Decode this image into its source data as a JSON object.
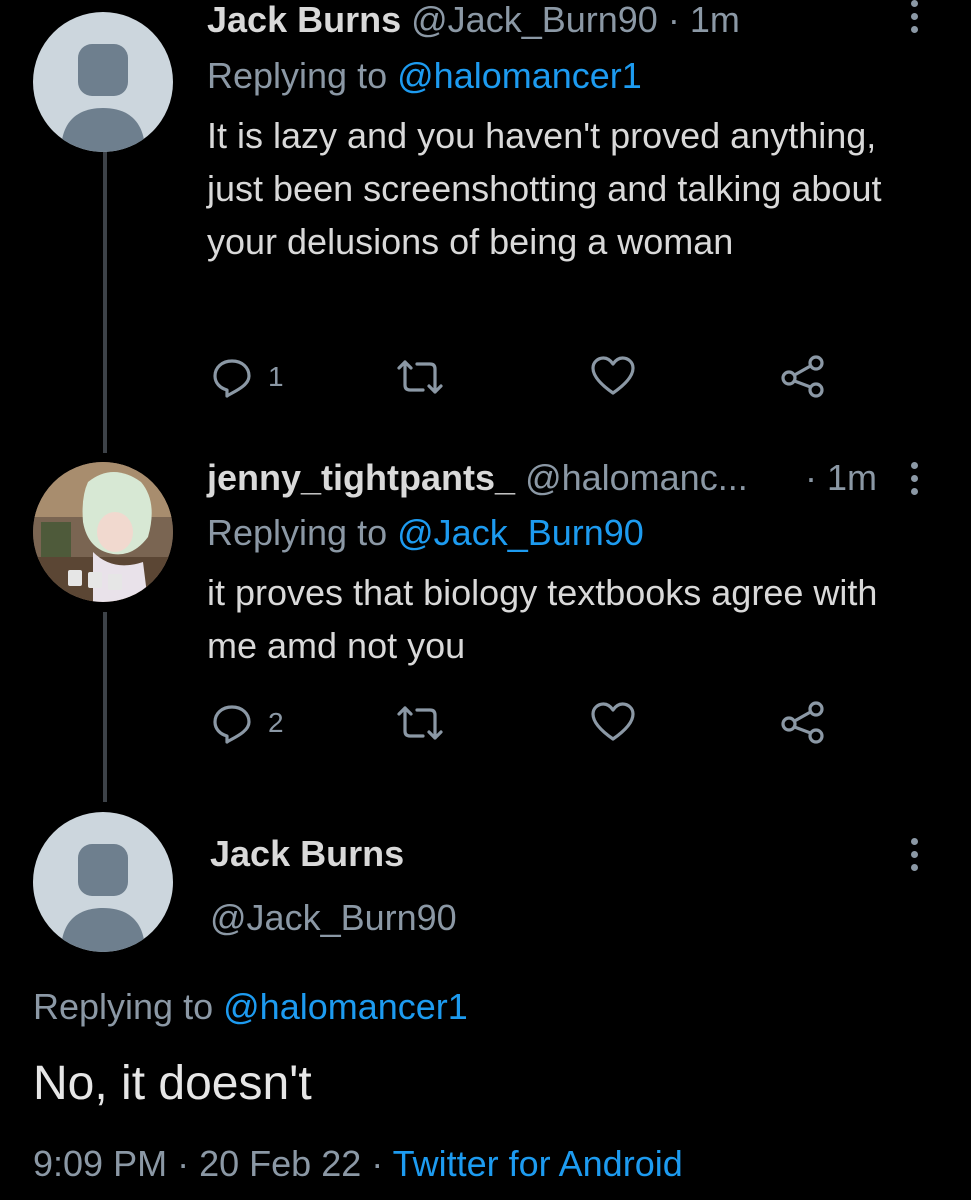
{
  "tweets": [
    {
      "name": "Jack Burns",
      "handle": "@Jack_Burn90",
      "time": "· 1m",
      "replying_label": "Replying to",
      "replying_to": "@halomancer1",
      "text": "It is lazy and you haven't proved anything, just been screenshotting and talking about your delusions of being a woman",
      "reply_count": "1"
    },
    {
      "name": "jenny_tightpants_",
      "handle": "@halomanc...",
      "time": "· 1m",
      "replying_label": "Replying to",
      "replying_to": "@Jack_Burn90",
      "text": "it proves that biology textbooks agree with me amd not you",
      "reply_count": "2"
    }
  ],
  "main": {
    "name": "Jack Burns",
    "handle": "@Jack_Burn90",
    "replying_label": "Replying to",
    "replying_to": "@halomancer1",
    "text": "No, it doesn't",
    "time": "9:09 PM",
    "separator1": "·",
    "date": "20 Feb 22",
    "separator2": "·",
    "client": "Twitter for Android"
  },
  "icons": {
    "reply": "reply-bubble-icon",
    "retweet": "retweet-icon",
    "like": "heart-icon",
    "share": "share-icon",
    "more": "more-vertical-icon"
  },
  "colors": {
    "background": "#000000",
    "text": "#d9d9d9",
    "muted": "#8b98a5",
    "link": "#1d9bf0",
    "avatar_default": "#ccd6dd",
    "avatar_silhouette": "#6e7f8e"
  }
}
